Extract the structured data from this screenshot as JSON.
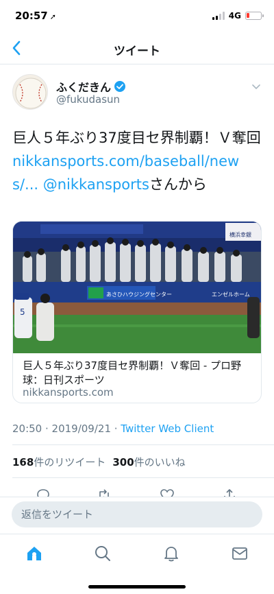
{
  "status_bar": {
    "time": "20:57",
    "network": "4G"
  },
  "nav": {
    "title": "ツイート"
  },
  "tweet": {
    "author_name": "ふくだきん",
    "author_handle": "@fukudasun",
    "avatar_text": "ふくだきん",
    "text_main": "巨人５年ぶり37度目セ界制覇！Ｖ奪回 ",
    "text_link": "nikkansports.com/baseball/news/...",
    "text_mention": " @nikkansports",
    "text_suffix": "さんから",
    "card": {
      "title": "巨人５年ぶり37度目セ界制覇！Ｖ奪回 - プロ野球：日刊スポーツ",
      "domain": "nikkansports.com",
      "image_sign_left": "あさひハウジングセンター",
      "image_sign_right": "エンゼルホーム",
      "image_banner": "横浜幸銀"
    },
    "timestamp": "20:50 · 2019/09/21 · ",
    "client": "Twitter Web Client",
    "retweets_count": "168",
    "retweets_label": "件のリツイート",
    "likes_count": "300",
    "likes_label": "件のいいね"
  },
  "reply": {
    "placeholder": "返信をツイート"
  },
  "colors": {
    "accent": "#1da1f2",
    "text": "#14171a",
    "muted": "#657786",
    "border": "#e1e8ed"
  }
}
